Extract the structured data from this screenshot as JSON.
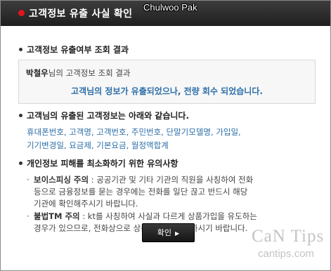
{
  "window": {
    "title": "고객정보 유출 사실 확인",
    "overlay_name": "Chulwoo Pak"
  },
  "section1": {
    "heading": "고객정보 유출여부 조회 결과",
    "user_name": "박철우",
    "result_title_suffix": "님의 고객정보 조회 결과",
    "result_message": "고객님의 정보가 유출되었으나, 전량 회수 되었습니다."
  },
  "section2": {
    "heading": "고객님의 유출된 고객정보는 아래와 같습니다.",
    "items_line1": "휴대폰번호, 고객명, 고객번호, 주민번호, 단말기모델명, 가입일,",
    "items_line2": "기기변경일, 요금제, 기본요금, 월정액합계"
  },
  "section3": {
    "heading": "개인정보 피해를 최소화하기 위한 유의사항",
    "voice_phishing_label": "보이스피싱 주의",
    "voice_phishing_line1": ": 공공기관 및 기타 기관의 직원을 사칭하여 전화",
    "voice_phishing_line2": "등으로 금융정보를 묻는 경우에는 전화를 일단 끊고 반드시 해당",
    "voice_phishing_line3": "기관에 확인해주시기 바랍니다.",
    "illegal_tm_label": "불법TM 주의",
    "illegal_tm_line1": ": kt를 사칭하여 사실과 다르게 상품가입을 유도하는",
    "illegal_tm_line2": "경우가 있으므로, 전화상으로 상품가입에 유의 하시기 바랍니다."
  },
  "buttons": {
    "confirm": "확인"
  },
  "watermark": {
    "brand": "CaN Tips",
    "site": "cantips.com"
  },
  "colors": {
    "accent_red": "#e0161b",
    "link_blue": "#2b6ea8",
    "titlebar": "#2a2a2a"
  }
}
